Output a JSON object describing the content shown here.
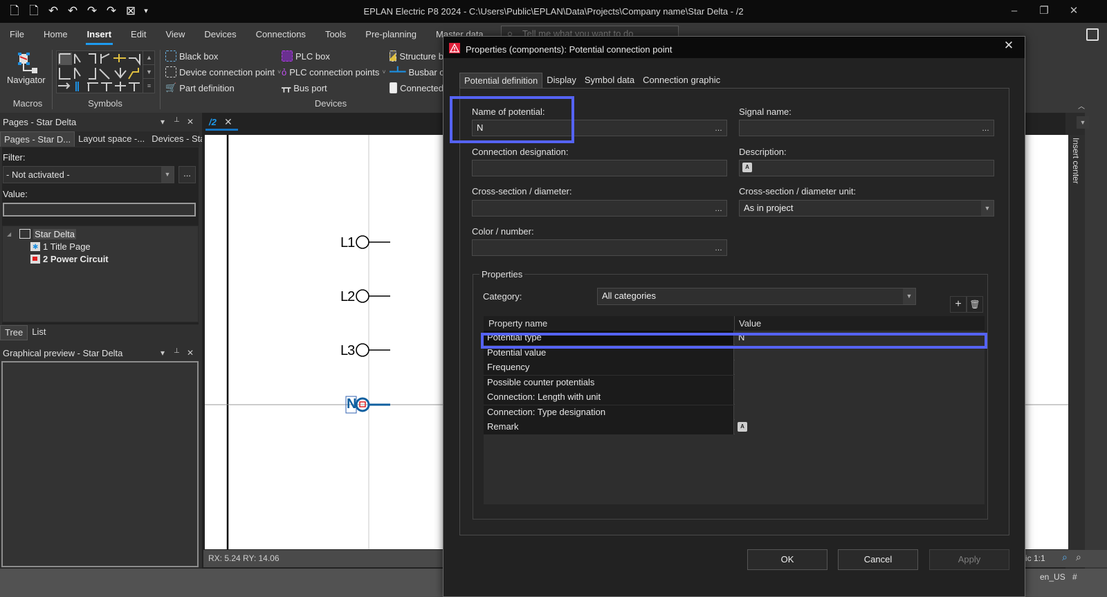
{
  "app": {
    "title": "EPLAN Electric P8 2024 - C:\\Users\\Public\\EPLAN\\Data\\Projects\\Company name\\Star Delta - /2",
    "window_controls": {
      "minimize": "–",
      "restore": "❐",
      "close": "✕"
    }
  },
  "quick_access": [
    {
      "name": "new-page",
      "glyph": "🗋"
    },
    {
      "name": "page-properties",
      "glyph": "🗋"
    },
    {
      "name": "undo-list",
      "glyph": "↶"
    },
    {
      "name": "undo",
      "glyph": "↶"
    },
    {
      "name": "redo",
      "glyph": "↷"
    },
    {
      "name": "redo-list",
      "glyph": "↷"
    },
    {
      "name": "close-project",
      "glyph": "⊠"
    },
    {
      "name": "customize",
      "glyph": "▾"
    }
  ],
  "ribbon": {
    "tabs": [
      "File",
      "Home",
      "Insert",
      "Edit",
      "View",
      "Devices",
      "Connections",
      "Tools",
      "Pre-planning",
      "Master data"
    ],
    "active_tab": "Insert",
    "search_placeholder": "Tell me what you want to do",
    "groups": {
      "macros": {
        "label": "Macros",
        "navigator": "Navigator"
      },
      "symbols": {
        "label": "Symbols"
      },
      "devices": {
        "label": "Devices",
        "col1": [
          "Black box",
          "Device connection point",
          "Part definition"
        ],
        "col2": [
          "PLC box",
          "PLC connection points",
          "Bus port"
        ],
        "col3": [
          "Structure b",
          "Busbar cor",
          "Connected"
        ]
      }
    }
  },
  "left_panel": {
    "title": "Pages - Star Delta",
    "ctrl": {
      "menu": "▾",
      "pin": "📌",
      "close": "✕"
    },
    "tabs": [
      "Pages - Star D...",
      "Layout space -...",
      "Devices - Star ..."
    ],
    "filter_label": "Filter:",
    "filter_value": "- Not activated -",
    "filter_more": "...",
    "value_label": "Value:",
    "value_input": "",
    "tree": {
      "root": "Star Delta",
      "children": [
        "1 Title Page",
        "2 Power Circuit"
      ]
    },
    "view_tabs": [
      "Tree",
      "List"
    ],
    "preview_title": "Graphical preview - Star Delta"
  },
  "document": {
    "tab_label": "/2",
    "coordinates": "RX: 5.24 RY: 14.06",
    "insert_center": "Insert center",
    "terminals": [
      "L1",
      "L2",
      "L3",
      "N"
    ],
    "status": {
      "scale": "ic 1:1",
      "locale": "en_US",
      "hash": "#"
    }
  },
  "dialog": {
    "title": "Properties (components): Potential connection point",
    "tabs": [
      "Potential definition",
      "Display",
      "Symbol data",
      "Connection graphic"
    ],
    "active_tab": "Potential definition",
    "fields": {
      "name_of_potential": {
        "label": "Name of potential:",
        "value": "N"
      },
      "signal_name": {
        "label": "Signal name:",
        "value": ""
      },
      "connection_designation": {
        "label": "Connection designation:",
        "value": ""
      },
      "description": {
        "label": "Description:",
        "value": ""
      },
      "cross_section": {
        "label": "Cross-section / diameter:",
        "value": ""
      },
      "cross_section_unit": {
        "label": "Cross-section / diameter unit:",
        "value": "As in project"
      },
      "color_number": {
        "label": "Color / number:",
        "value": ""
      }
    },
    "properties": {
      "group_label": "Properties",
      "category_label": "Category:",
      "category_value": "All categories",
      "columns": [
        "Property name",
        "Value"
      ],
      "rows": [
        {
          "name": "Potential type",
          "value": "N"
        },
        {
          "name": "Potential value",
          "value": ""
        },
        {
          "name": "Frequency",
          "value": ""
        },
        {
          "name": "Possible counter potentials",
          "value": ""
        },
        {
          "name": "Connection: Length with unit",
          "value": ""
        },
        {
          "name": "Connection: Type designation",
          "value": ""
        },
        {
          "name": "Remark",
          "value": ""
        }
      ]
    },
    "buttons": {
      "ok": "OK",
      "cancel": "Cancel",
      "apply": "Apply"
    },
    "highlight_color": "#5563f5"
  }
}
